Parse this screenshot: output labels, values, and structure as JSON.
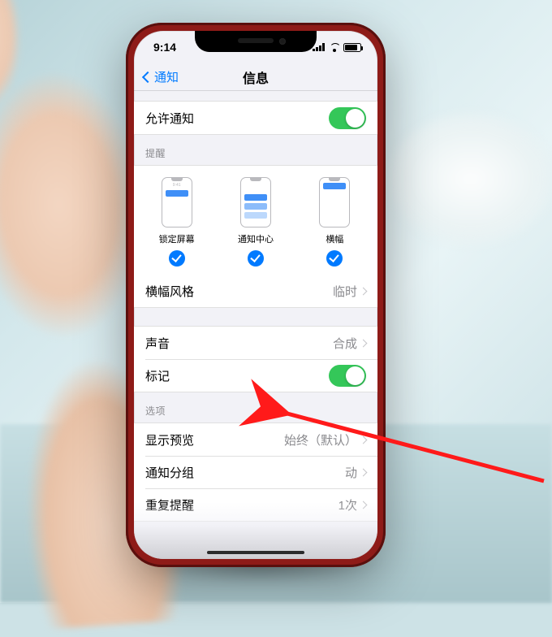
{
  "status": {
    "time": "9:14"
  },
  "nav": {
    "back": "通知",
    "title": "信息"
  },
  "allow": {
    "label": "允许通知",
    "on": true
  },
  "alerts": {
    "header": "提醒",
    "options": [
      {
        "label": "锁定屏幕",
        "mini_time": "9:41"
      },
      {
        "label": "通知中心",
        "mini_time": ""
      },
      {
        "label": "横幅",
        "mini_time": ""
      }
    ],
    "banner_style": {
      "label": "横幅风格",
      "value": "临时"
    }
  },
  "sound": {
    "label": "声音",
    "value": "合成"
  },
  "badge": {
    "label": "标记",
    "on": true
  },
  "options": {
    "header": "选项",
    "preview": {
      "label": "显示预览",
      "value": "始终（默认）"
    },
    "grouping": {
      "label": "通知分组",
      "value": "动"
    },
    "repeat": {
      "label": "重复提醒",
      "value": "1次"
    }
  }
}
